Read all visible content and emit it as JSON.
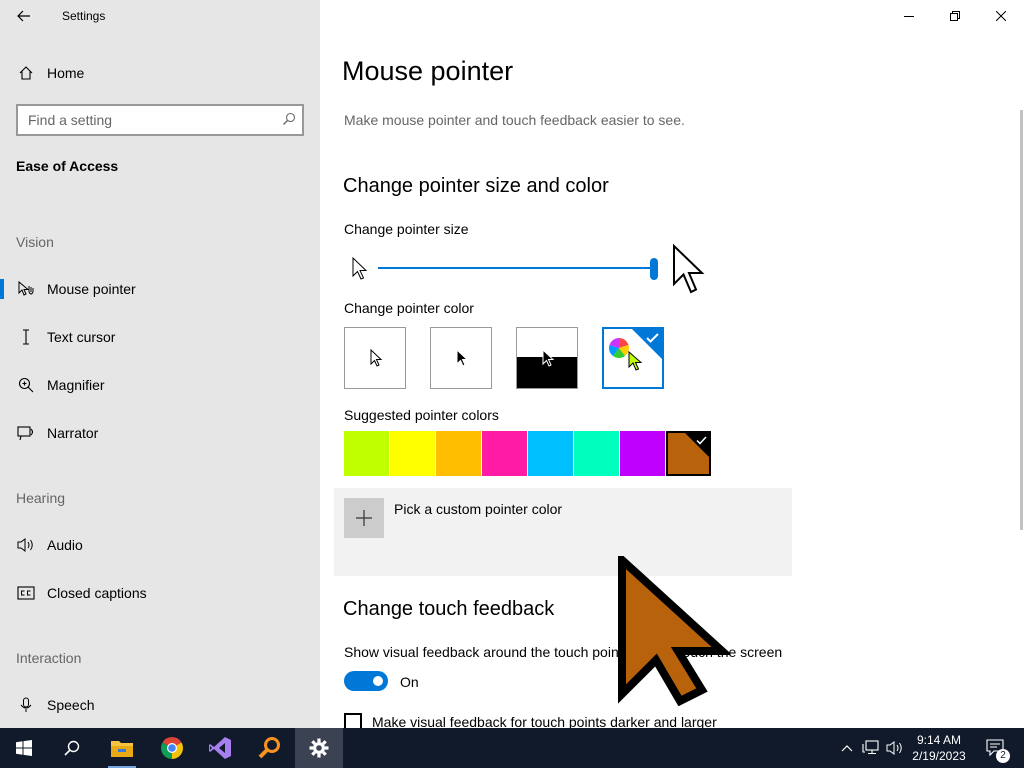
{
  "window": {
    "title": "Settings",
    "back_icon": "back-arrow-icon",
    "controls": [
      "minimize-icon",
      "restore-icon",
      "close-icon"
    ]
  },
  "sidebar": {
    "home_label": "Home",
    "search_placeholder": "Find a setting",
    "category": "Ease of Access",
    "sections": [
      {
        "header": "Vision",
        "items": [
          {
            "label": "Mouse pointer",
            "icon": "mouse-pointer-icon",
            "selected": true
          },
          {
            "label": "Text cursor",
            "icon": "text-cursor-icon"
          },
          {
            "label": "Magnifier",
            "icon": "magnifier-icon"
          },
          {
            "label": "Narrator",
            "icon": "narrator-icon"
          }
        ]
      },
      {
        "header": "Hearing",
        "items": [
          {
            "label": "Audio",
            "icon": "speaker-icon"
          },
          {
            "label": "Closed captions",
            "icon": "closed-captions-icon"
          }
        ]
      },
      {
        "header": "Interaction",
        "items": [
          {
            "label": "Speech",
            "icon": "microphone-icon"
          }
        ]
      }
    ]
  },
  "main": {
    "title": "Mouse pointer",
    "description": "Make mouse pointer and touch feedback easier to see.",
    "size_color_heading": "Change pointer size and color",
    "size_label": "Change pointer size",
    "size_slider_level": 1.0,
    "color_label": "Change pointer color",
    "color_options": [
      {
        "name": "white",
        "selected": false
      },
      {
        "name": "black",
        "selected": false
      },
      {
        "name": "inverted",
        "selected": false
      },
      {
        "name": "custom",
        "selected": true
      }
    ],
    "suggested_label": "Suggested pointer colors",
    "suggested_colors": [
      "#bfff00",
      "#ffff00",
      "#ffbf00",
      "#ff1ba6",
      "#00bfff",
      "#00ffbf",
      "#bf00ff",
      "#b8630c"
    ],
    "selected_suggested_index": 7,
    "custom_color_label": "Pick a custom pointer color",
    "touch_heading": "Change touch feedback",
    "touch_visual_label": "Show visual feedback around the touch points when I touch the screen",
    "touch_toggle_state": "On",
    "touch_darker_label": "Make visual feedback for touch points darker and larger",
    "touch_darker_checked": false
  },
  "accent": "#0078d7",
  "pointer_color": "#b8630c",
  "taskbar": {
    "apps": [
      "start-icon",
      "search-icon",
      "file-explorer-icon",
      "chrome-icon",
      "visual-studio-icon",
      "search-tool-icon",
      "settings-icon"
    ],
    "time": "9:14 AM",
    "date": "2/19/2023",
    "notification_count": "2"
  }
}
